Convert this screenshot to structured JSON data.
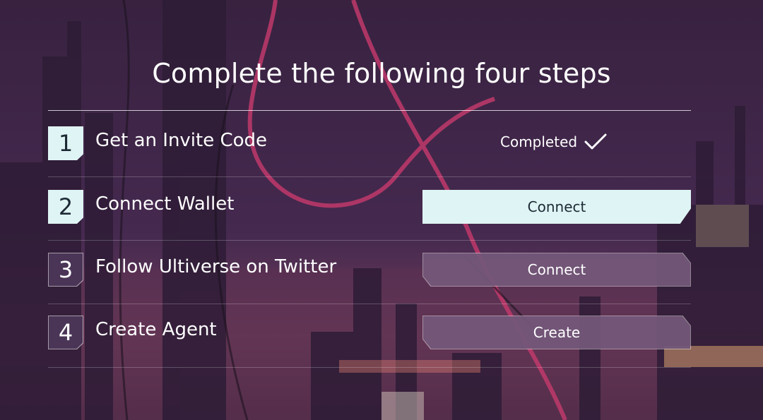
{
  "title": "Complete the following four steps",
  "steps": [
    {
      "number": "1",
      "label": "Get an Invite Code",
      "status": "Completed",
      "status_icon": "check-icon"
    },
    {
      "number": "2",
      "label": "Connect Wallet",
      "action": "Connect"
    },
    {
      "number": "3",
      "label": "Follow Ultiverse on Twitter",
      "action": "Connect"
    },
    {
      "number": "4",
      "label": "Create Agent",
      "action": "Create"
    }
  ],
  "colors": {
    "accent": "#dff4f4",
    "background": "#432a4d",
    "text": "#ffffff"
  }
}
